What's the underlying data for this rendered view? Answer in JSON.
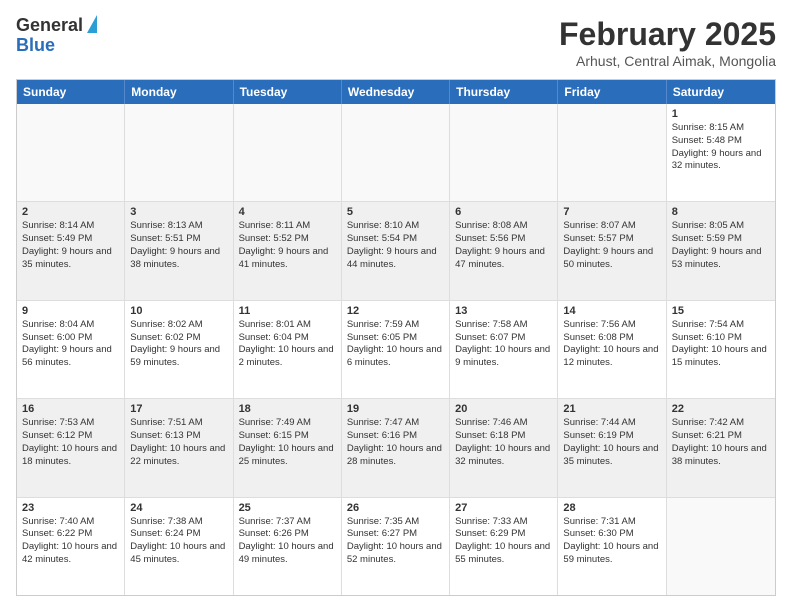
{
  "header": {
    "logo_general": "General",
    "logo_blue": "Blue",
    "month_title": "February 2025",
    "subtitle": "Arhust, Central Aimak, Mongolia"
  },
  "days_of_week": [
    "Sunday",
    "Monday",
    "Tuesday",
    "Wednesday",
    "Thursday",
    "Friday",
    "Saturday"
  ],
  "weeks": [
    [
      {
        "day": "",
        "text": "",
        "empty": true
      },
      {
        "day": "",
        "text": "",
        "empty": true
      },
      {
        "day": "",
        "text": "",
        "empty": true
      },
      {
        "day": "",
        "text": "",
        "empty": true
      },
      {
        "day": "",
        "text": "",
        "empty": true
      },
      {
        "day": "",
        "text": "",
        "empty": true
      },
      {
        "day": "1",
        "text": "Sunrise: 8:15 AM\nSunset: 5:48 PM\nDaylight: 9 hours and 32 minutes."
      }
    ],
    [
      {
        "day": "2",
        "text": "Sunrise: 8:14 AM\nSunset: 5:49 PM\nDaylight: 9 hours and 35 minutes."
      },
      {
        "day": "3",
        "text": "Sunrise: 8:13 AM\nSunset: 5:51 PM\nDaylight: 9 hours and 38 minutes."
      },
      {
        "day": "4",
        "text": "Sunrise: 8:11 AM\nSunset: 5:52 PM\nDaylight: 9 hours and 41 minutes."
      },
      {
        "day": "5",
        "text": "Sunrise: 8:10 AM\nSunset: 5:54 PM\nDaylight: 9 hours and 44 minutes."
      },
      {
        "day": "6",
        "text": "Sunrise: 8:08 AM\nSunset: 5:56 PM\nDaylight: 9 hours and 47 minutes."
      },
      {
        "day": "7",
        "text": "Sunrise: 8:07 AM\nSunset: 5:57 PM\nDaylight: 9 hours and 50 minutes."
      },
      {
        "day": "8",
        "text": "Sunrise: 8:05 AM\nSunset: 5:59 PM\nDaylight: 9 hours and 53 minutes."
      }
    ],
    [
      {
        "day": "9",
        "text": "Sunrise: 8:04 AM\nSunset: 6:00 PM\nDaylight: 9 hours and 56 minutes."
      },
      {
        "day": "10",
        "text": "Sunrise: 8:02 AM\nSunset: 6:02 PM\nDaylight: 9 hours and 59 minutes."
      },
      {
        "day": "11",
        "text": "Sunrise: 8:01 AM\nSunset: 6:04 PM\nDaylight: 10 hours and 2 minutes."
      },
      {
        "day": "12",
        "text": "Sunrise: 7:59 AM\nSunset: 6:05 PM\nDaylight: 10 hours and 6 minutes."
      },
      {
        "day": "13",
        "text": "Sunrise: 7:58 AM\nSunset: 6:07 PM\nDaylight: 10 hours and 9 minutes."
      },
      {
        "day": "14",
        "text": "Sunrise: 7:56 AM\nSunset: 6:08 PM\nDaylight: 10 hours and 12 minutes."
      },
      {
        "day": "15",
        "text": "Sunrise: 7:54 AM\nSunset: 6:10 PM\nDaylight: 10 hours and 15 minutes."
      }
    ],
    [
      {
        "day": "16",
        "text": "Sunrise: 7:53 AM\nSunset: 6:12 PM\nDaylight: 10 hours and 18 minutes."
      },
      {
        "day": "17",
        "text": "Sunrise: 7:51 AM\nSunset: 6:13 PM\nDaylight: 10 hours and 22 minutes."
      },
      {
        "day": "18",
        "text": "Sunrise: 7:49 AM\nSunset: 6:15 PM\nDaylight: 10 hours and 25 minutes."
      },
      {
        "day": "19",
        "text": "Sunrise: 7:47 AM\nSunset: 6:16 PM\nDaylight: 10 hours and 28 minutes."
      },
      {
        "day": "20",
        "text": "Sunrise: 7:46 AM\nSunset: 6:18 PM\nDaylight: 10 hours and 32 minutes."
      },
      {
        "day": "21",
        "text": "Sunrise: 7:44 AM\nSunset: 6:19 PM\nDaylight: 10 hours and 35 minutes."
      },
      {
        "day": "22",
        "text": "Sunrise: 7:42 AM\nSunset: 6:21 PM\nDaylight: 10 hours and 38 minutes."
      }
    ],
    [
      {
        "day": "23",
        "text": "Sunrise: 7:40 AM\nSunset: 6:22 PM\nDaylight: 10 hours and 42 minutes."
      },
      {
        "day": "24",
        "text": "Sunrise: 7:38 AM\nSunset: 6:24 PM\nDaylight: 10 hours and 45 minutes."
      },
      {
        "day": "25",
        "text": "Sunrise: 7:37 AM\nSunset: 6:26 PM\nDaylight: 10 hours and 49 minutes."
      },
      {
        "day": "26",
        "text": "Sunrise: 7:35 AM\nSunset: 6:27 PM\nDaylight: 10 hours and 52 minutes."
      },
      {
        "day": "27",
        "text": "Sunrise: 7:33 AM\nSunset: 6:29 PM\nDaylight: 10 hours and 55 minutes."
      },
      {
        "day": "28",
        "text": "Sunrise: 7:31 AM\nSunset: 6:30 PM\nDaylight: 10 hours and 59 minutes."
      },
      {
        "day": "",
        "text": "",
        "empty": true
      }
    ]
  ]
}
